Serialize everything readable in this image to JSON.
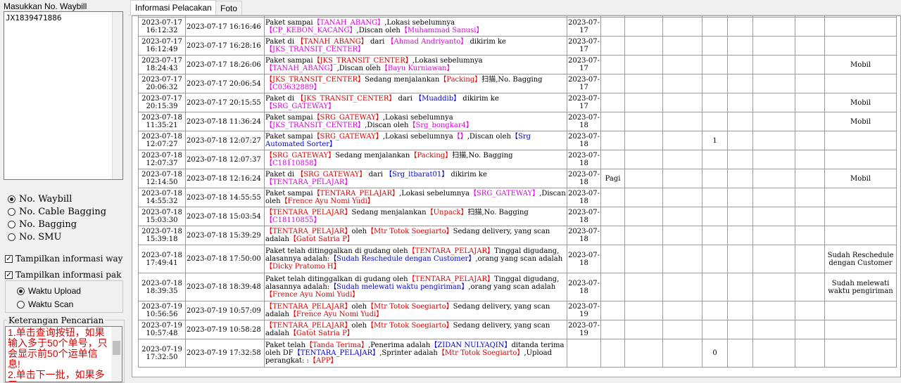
{
  "left_panel": {
    "title": "Masukkan No. Waybill",
    "waybill_value": "JX1839471886",
    "radios": [
      {
        "label": "No. Waybill",
        "selected": true
      },
      {
        "label": "No. Cable Bagging",
        "selected": false
      },
      {
        "label": "No. Bagging",
        "selected": false
      },
      {
        "label": "No. SMU",
        "selected": false
      }
    ],
    "checks": [
      {
        "label": "Tampilkan informasi way",
        "checked": true
      },
      {
        "label": "Tampilkan informasi pak",
        "checked": true
      }
    ],
    "time_radios": [
      {
        "label": "Waktu Upload",
        "selected": true
      },
      {
        "label": "Waktu Scan",
        "selected": false
      }
    ],
    "keterangan_label": "Keterangan Pencarian",
    "keterangan_text": "1.单击查询按钮，如果输入多于50个单号，只会显示前50个运单信息!\n2.单击下一批，如果多于"
  },
  "tabs": [
    {
      "label": "Informasi Pelacakan",
      "active": true
    },
    {
      "label": "Foto",
      "active": false
    }
  ],
  "rows": [
    {
      "scan_date": "2023-07-17",
      "scan_time": "16:12:32",
      "upload": "2023-07-17 16:16:46",
      "desc": [
        [
          "Paket sampai",
          ""
        ],
        [
          "【TANAH_ABANG】",
          "m"
        ],
        [
          ",Lokasi sebelumnya",
          ""
        ],
        [
          "【CP_KEBON_KACANG】",
          "m"
        ],
        [
          ",Discan oleh",
          ""
        ],
        [
          "【Muhammad Sanusi】",
          "m"
        ]
      ],
      "d1": "2023-07-",
      "d2": "17",
      "col_e": "",
      "col_h": "",
      "col_l": ""
    },
    {
      "scan_date": "2023-07-17",
      "scan_time": "16:12:49",
      "upload": "2023-07-17 16:28:16",
      "desc": [
        [
          "Paket di ",
          ""
        ],
        [
          "【TANAH_ABANG】",
          "r"
        ],
        [
          " dari ",
          ""
        ],
        [
          "【Ahmad Andriyanto】",
          "m"
        ],
        [
          " dikirim ke",
          ""
        ],
        [
          "【JKS_TRANSIT_CENTER】",
          "m"
        ]
      ],
      "d1": "2023-07-",
      "d2": "17",
      "col_e": "",
      "col_h": "",
      "col_l": ""
    },
    {
      "scan_date": "2023-07-17",
      "scan_time": "18:24:43",
      "upload": "2023-07-17 18:26:06",
      "desc": [
        [
          "Paket sampai",
          ""
        ],
        [
          "【JKS_TRANSIT_CENTER】",
          "r"
        ],
        [
          ",Lokasi sebelumnya",
          ""
        ],
        [
          "【TANAH_ABANG】",
          "m"
        ],
        [
          ",Discan oleh",
          ""
        ],
        [
          "【Bayu Kurniawan】",
          "m"
        ]
      ],
      "d1": "2023-07-",
      "d2": "17",
      "col_e": "",
      "col_h": "",
      "col_l": "Mobil"
    },
    {
      "scan_date": "2023-07-17",
      "scan_time": "20:06:32",
      "upload": "2023-07-17 20:06:54",
      "desc": [
        [
          "【JKS_TRANSIT_CENTER】",
          "r"
        ],
        [
          "Sedang menjalankan",
          ""
        ],
        [
          "【Packing】",
          "r"
        ],
        [
          "扫描,No. Bagging",
          ""
        ],
        [
          "【C03632889】",
          "m"
        ]
      ],
      "d1": "2023-07-",
      "d2": "17",
      "col_e": "",
      "col_h": "",
      "col_l": ""
    },
    {
      "scan_date": "2023-07-17",
      "scan_time": "20:15:39",
      "upload": "2023-07-17 20:15:55",
      "desc": [
        [
          "Paket di ",
          ""
        ],
        [
          "【JKS_TRANSIT_CENTER】",
          "r"
        ],
        [
          " dari ",
          ""
        ],
        [
          "【Muaddib】",
          "b"
        ],
        [
          " dikirim ke",
          ""
        ],
        [
          "【SRG_GATEWAY】",
          "m"
        ]
      ],
      "d1": "2023-07-",
      "d2": "17",
      "col_e": "",
      "col_h": "",
      "col_l": "Mobil"
    },
    {
      "scan_date": "2023-07-18",
      "scan_time": "11:35:21",
      "upload": "2023-07-18 11:36:24",
      "desc": [
        [
          "Paket sampai",
          ""
        ],
        [
          "【SRG_GATEWAY】",
          "r"
        ],
        [
          ",Lokasi sebelumnya",
          ""
        ],
        [
          "【JKS_TRANSIT_CENTER】",
          "m"
        ],
        [
          ",Discan oleh",
          ""
        ],
        [
          "【Srg_bongkar4】",
          "m"
        ]
      ],
      "d1": "2023-07-",
      "d2": "18",
      "col_e": "",
      "col_h": "",
      "col_l": "Mobil"
    },
    {
      "scan_date": "2023-07-18",
      "scan_time": "12:07:27",
      "upload": "2023-07-18 12:07:27",
      "desc": [
        [
          "Paket sampai",
          ""
        ],
        [
          "【SRG_GATEWAY】",
          "r"
        ],
        [
          ",Lokasi sebelumnya",
          ""
        ],
        [
          "【】",
          "m"
        ],
        [
          ",Discan oleh",
          ""
        ],
        [
          "【Srg Automated Sorter】",
          "b"
        ]
      ],
      "d1": "2023-07-",
      "d2": "18",
      "col_e": "",
      "col_h": "1",
      "col_l": ""
    },
    {
      "scan_date": "2023-07-18",
      "scan_time": "12:07:37",
      "upload": "2023-07-18 12:07:37",
      "desc": [
        [
          "【SRG_GATEWAY】",
          "r"
        ],
        [
          "Sedang menjalankan",
          ""
        ],
        [
          "【Packing】",
          "r"
        ],
        [
          "扫描,No. Bagging",
          ""
        ],
        [
          "【C18110858】",
          "m"
        ]
      ],
      "d1": "2023-07-",
      "d2": "18",
      "col_e": "",
      "col_h": "",
      "col_l": ""
    },
    {
      "scan_date": "2023-07-18",
      "scan_time": "12:14:50",
      "upload": "2023-07-18 12:16:24",
      "desc": [
        [
          "Paket di ",
          ""
        ],
        [
          "【SRG_GATEWAY】",
          "r"
        ],
        [
          " dari ",
          ""
        ],
        [
          "【Srg_ltbarat01】",
          "b"
        ],
        [
          " dikirim ke",
          ""
        ],
        [
          "【TENTARA_PELAJAR】",
          "m"
        ]
      ],
      "d1": "2023-07-",
      "d2": "18",
      "col_e": "Pagi",
      "col_h": "",
      "col_l": "Mobil"
    },
    {
      "scan_date": "2023-07-18",
      "scan_time": "14:55:32",
      "upload": "2023-07-18 14:55:55",
      "desc": [
        [
          "Paket sampai",
          ""
        ],
        [
          "【TENTARA_PELAJAR】",
          "r"
        ],
        [
          ",Lokasi sebelumnya",
          ""
        ],
        [
          "【SRG_GATEWAY】",
          "m"
        ],
        [
          ",Discan oleh",
          ""
        ],
        [
          "【Frence Ayu Nomi Yudi】",
          "r"
        ]
      ],
      "d1": "2023-07-",
      "d2": "18",
      "col_e": "",
      "col_h": "",
      "col_l": ""
    },
    {
      "scan_date": "2023-07-18",
      "scan_time": "15:03:30",
      "upload": "2023-07-18 15:03:54",
      "desc": [
        [
          "【TENTARA_PELAJAR】",
          "r"
        ],
        [
          "Sedang menjalankan",
          ""
        ],
        [
          "【Unpack】",
          "r"
        ],
        [
          "扫描,No. Bagging",
          ""
        ],
        [
          "【C18110855】",
          "m"
        ]
      ],
      "d1": "2023-07-",
      "d2": "18",
      "col_e": "",
      "col_h": "",
      "col_l": ""
    },
    {
      "scan_date": "2023-07-18",
      "scan_time": "15:39:18",
      "upload": "2023-07-18 15:39:29",
      "desc": [
        [
          "【TENTARA_PELAJAR】",
          "r"
        ],
        [
          "oleh",
          ""
        ],
        [
          "【Mtr Totok Soegiarto】",
          "r"
        ],
        [
          "Sedang delivery, yang scan adalah",
          ""
        ],
        [
          "【Gatot Satria P】",
          "r"
        ]
      ],
      "d1": "2023-07-",
      "d2": "18",
      "col_e": "",
      "col_h": "",
      "col_l": ""
    },
    {
      "scan_date": "2023-07-18",
      "scan_time": "17:49:41",
      "upload": "2023-07-18 17:50:00",
      "desc": [
        [
          "Paket telah ditinggalkan di gudang oleh",
          ""
        ],
        [
          "【TENTARA_PELAJAR】",
          "r"
        ],
        [
          "Tinggal digudang, alasannya adalah:",
          ""
        ],
        [
          "【Sudah Reschedule dengan Customer】",
          "b"
        ],
        [
          ",orang yang scan adalah",
          ""
        ],
        [
          "【Dicky Pratomo H】",
          "r"
        ]
      ],
      "d1": "2023-07-",
      "d2": "18",
      "col_e": "",
      "col_h": "",
      "col_l": "Sudah Reschedule dengan Customer"
    },
    {
      "scan_date": "2023-07-18",
      "scan_time": "18:39:35",
      "upload": "2023-07-18 18:39:48",
      "desc": [
        [
          "Paket telah ditinggalkan di gudang oleh",
          ""
        ],
        [
          "【TENTARA_PELAJAR】",
          "r"
        ],
        [
          "Tinggal digudang, alasannya adalah:",
          ""
        ],
        [
          "【Sudah melewati waktu pengiriman】",
          "b"
        ],
        [
          ",orang yang scan adalah",
          ""
        ],
        [
          "【Frence Ayu Nomi Yudi】",
          "r"
        ]
      ],
      "d1": "2023-07-",
      "d2": "18",
      "col_e": "",
      "col_h": "",
      "col_l": "Sudah melewati waktu pengiriman"
    },
    {
      "scan_date": "2023-07-19",
      "scan_time": "10:56:56",
      "upload": "2023-07-19 10:57:09",
      "desc": [
        [
          "【TENTARA_PELAJAR】",
          "r"
        ],
        [
          "oleh",
          ""
        ],
        [
          "【Mtr Totok Soegiarto】",
          "r"
        ],
        [
          "Sedang delivery, yang scan adalah",
          ""
        ],
        [
          "【Frence Ayu Nomi Yudi】",
          "r"
        ]
      ],
      "d1": "2023-07-",
      "d2": "19",
      "col_e": "",
      "col_h": "",
      "col_l": ""
    },
    {
      "scan_date": "2023-07-19",
      "scan_time": "10:57:48",
      "upload": "2023-07-19 10:58:28",
      "desc": [
        [
          "【TENTARA_PELAJAR】",
          "r"
        ],
        [
          "oleh",
          ""
        ],
        [
          "【Mtr Totok Soegiarto】",
          "r"
        ],
        [
          "Sedang delivery, yang scan adalah",
          ""
        ],
        [
          "【Gatot Satria P】",
          "r"
        ]
      ],
      "d1": "2023-07-",
      "d2": "19",
      "col_e": "",
      "col_h": "",
      "col_l": ""
    },
    {
      "scan_date": "2023-07-19",
      "scan_time": "17:32:50",
      "upload": "2023-07-19 17:32:58",
      "desc": [
        [
          "Paket telah",
          ""
        ],
        [
          "【Tanda Terima】",
          "r"
        ],
        [
          ",Penerima adalah",
          ""
        ],
        [
          "【ZIDAN NULYAQIN】",
          "b"
        ],
        [
          "ditanda terima oleh DF",
          ""
        ],
        [
          "【TENTARA_PELAJAR】",
          "b"
        ],
        [
          ",Sprinter adalah",
          ""
        ],
        [
          "【Mtr Totok Soegiarto】",
          "r"
        ],
        [
          ",Upload perangkat: :",
          ""
        ],
        [
          "【APP】",
          "r"
        ]
      ],
      "d1": "",
      "d2": "",
      "col_e": "",
      "col_h": "0",
      "col_l": ""
    }
  ]
}
